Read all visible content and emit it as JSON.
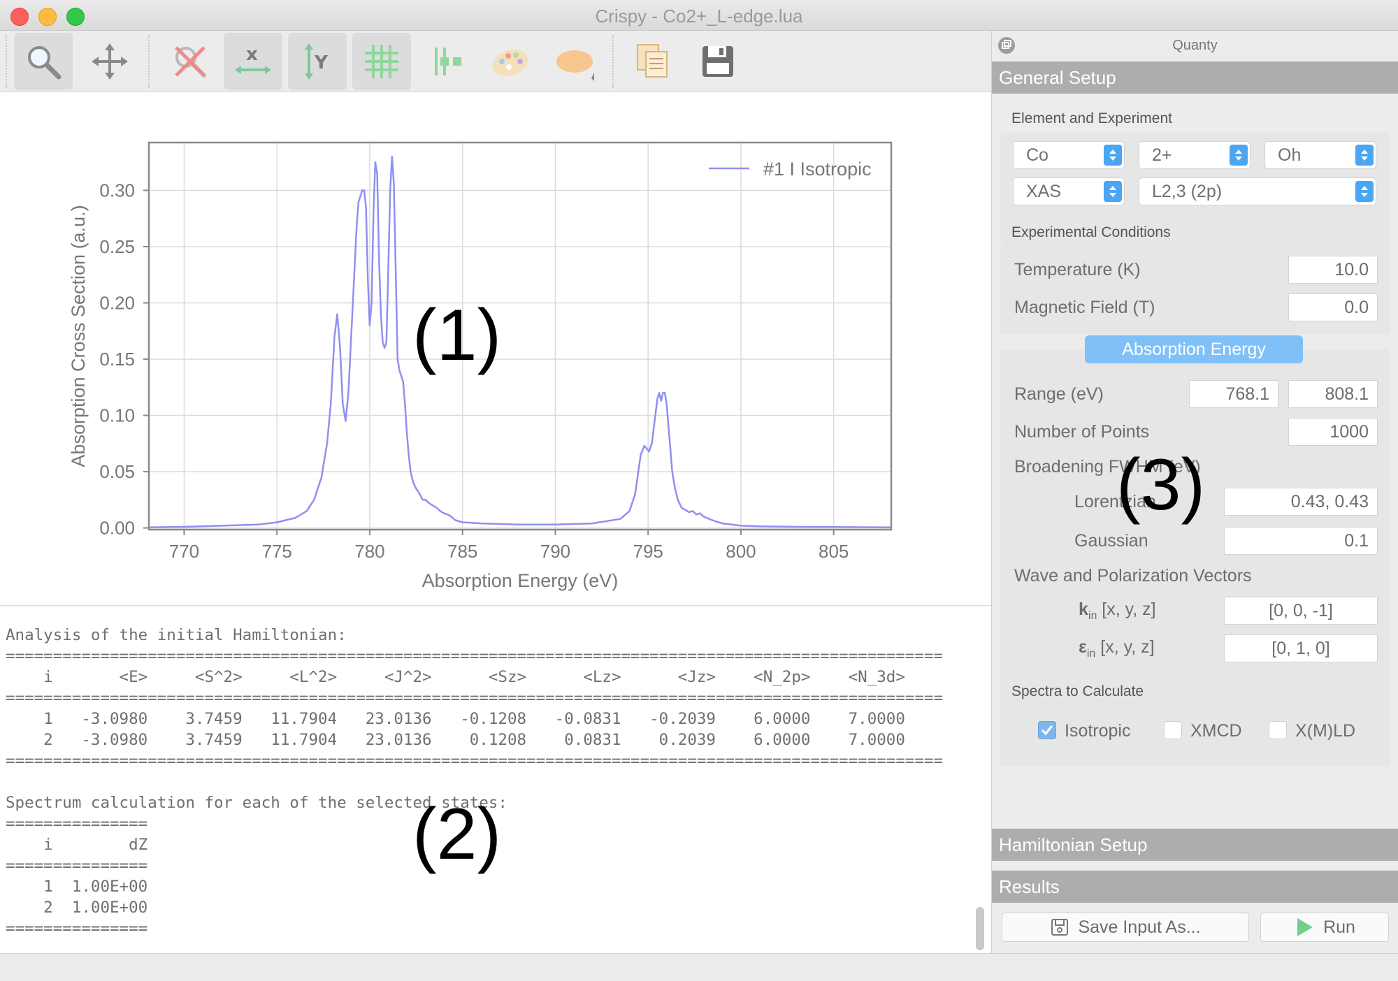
{
  "window": {
    "title": "Crispy - Co2+_L-edge.lua"
  },
  "toolbar": {
    "icons": [
      "magnifier-icon",
      "pan-arrows-icon",
      "reset-zoom-icon",
      "x-autoscale-icon",
      "y-autoscale-icon",
      "grid-icon",
      "curve-style-icon",
      "colormap-palette-icon",
      "shape-icon",
      "copy-icon",
      "save-icon"
    ]
  },
  "chart_data": {
    "type": "line",
    "xlabel": "Absorption Energy (eV)",
    "ylabel": "Absorption Cross Section (a.u.)",
    "xlim": [
      768.1,
      808.1
    ],
    "ylim": [
      -0.0015,
      0.3425
    ],
    "xticks": [
      770,
      775,
      780,
      785,
      790,
      795,
      800,
      805
    ],
    "yticks": [
      0.0,
      0.05,
      0.1,
      0.15,
      0.2,
      0.25,
      0.3
    ],
    "ytick_labels": [
      "0.00",
      "0.05",
      "0.10",
      "0.15",
      "0.20",
      "0.25",
      "0.30"
    ],
    "grid": true,
    "legend_position": "top-right",
    "series": [
      {
        "name": "#1 I Isotropic",
        "color": "#8f90f0",
        "x": [
          768.1,
          770,
          772,
          774,
          775,
          776,
          776.6,
          777,
          777.4,
          777.7,
          777.9,
          778.1,
          778.25,
          778.4,
          778.55,
          778.7,
          778.85,
          779.0,
          779.15,
          779.3,
          779.4,
          779.5,
          779.6,
          779.7,
          779.8,
          779.9,
          780.0,
          780.1,
          780.2,
          780.3,
          780.4,
          780.5,
          780.6,
          780.7,
          780.8,
          780.9,
          781.0,
          781.1,
          781.2,
          781.3,
          781.4,
          781.5,
          781.6,
          781.7,
          781.8,
          781.9,
          782.0,
          782.1,
          782.2,
          782.35,
          782.5,
          782.7,
          782.85,
          783.0,
          783.2,
          783.4,
          783.6,
          783.8,
          784.0,
          784.2,
          784.4,
          784.6,
          785,
          786,
          787,
          788,
          790,
          792,
          793.5,
          794,
          794.3,
          794.6,
          794.8,
          794.95,
          795.05,
          795.2,
          795.35,
          795.5,
          795.6,
          795.7,
          795.8,
          795.9,
          796.0,
          796.1,
          796.2,
          796.3,
          796.45,
          796.6,
          796.8,
          797.0,
          797.2,
          797.4,
          797.6,
          797.8,
          798.0,
          798.3,
          798.6,
          799,
          799.5,
          800,
          801,
          803,
          805,
          808.1
        ],
        "y": [
          0.0005,
          0.001,
          0.002,
          0.003,
          0.005,
          0.009,
          0.015,
          0.025,
          0.045,
          0.075,
          0.11,
          0.17,
          0.19,
          0.16,
          0.11,
          0.095,
          0.12,
          0.17,
          0.22,
          0.27,
          0.29,
          0.295,
          0.3,
          0.3,
          0.285,
          0.22,
          0.18,
          0.2,
          0.28,
          0.325,
          0.315,
          0.24,
          0.19,
          0.165,
          0.16,
          0.165,
          0.23,
          0.3,
          0.33,
          0.305,
          0.23,
          0.15,
          0.14,
          0.135,
          0.13,
          0.11,
          0.085,
          0.065,
          0.05,
          0.04,
          0.035,
          0.03,
          0.025,
          0.025,
          0.022,
          0.02,
          0.018,
          0.015,
          0.013,
          0.012,
          0.01,
          0.007,
          0.005,
          0.004,
          0.0035,
          0.003,
          0.003,
          0.004,
          0.008,
          0.015,
          0.03,
          0.065,
          0.073,
          0.07,
          0.068,
          0.075,
          0.095,
          0.115,
          0.12,
          0.113,
          0.12,
          0.12,
          0.11,
          0.09,
          0.07,
          0.05,
          0.035,
          0.025,
          0.018,
          0.016,
          0.014,
          0.015,
          0.012,
          0.013,
          0.01,
          0.008,
          0.006,
          0.004,
          0.003,
          0.002,
          0.0015,
          0.001,
          0.0008,
          0.0005
        ]
      }
    ]
  },
  "annotations": {
    "plot": "(1)",
    "log": "(2)",
    "dock": "(3)"
  },
  "log": {
    "text": "Analysis of the initial Hamiltonian:\n===================================================================================================\n    i       <E>     <S^2>     <L^2>     <J^2>      <Sz>      <Lz>      <Jz>    <N_2p>    <N_3d>\n===================================================================================================\n    1   -3.0980    3.7459   11.7904   23.0136   -0.1208   -0.0831   -0.2039    6.0000    7.0000\n    2   -3.0980    3.7459   11.7904   23.0136    0.1208    0.0831    0.2039    6.0000    7.0000\n===================================================================================================\n\nSpectrum calculation for each of the selected states:\n===============\n    i        dZ\n===============\n    1  1.00E+00\n    2  1.00E+00\n==============="
  },
  "dock": {
    "title": "Quanty",
    "general_setup": "General Setup",
    "element_experiment": "Element and Experiment",
    "element": "Co",
    "charge": "2+",
    "symmetry": "Oh",
    "experiment": "XAS",
    "edge": "L2,3 (2p)",
    "experimental_conditions": "Experimental Conditions",
    "temperature_label": "Temperature (K)",
    "temperature": "10.0",
    "magnetic_field_label": "Magnetic Field (T)",
    "magnetic_field": "0.0",
    "absorption_tab": "Absorption Energy",
    "range_label": "Range (eV)",
    "range_min": "768.1",
    "range_max": "808.1",
    "npoints_label": "Number of Points",
    "npoints": "1000",
    "broadening_label": "Broadening FWHM (eV)",
    "lorentzian_label": "Lorentzian",
    "lorentzian": "0.43, 0.43",
    "gaussian_label": "Gaussian",
    "gaussian": "0.1",
    "wave_label": "Wave and Polarization Vectors",
    "kin_symbol": "k",
    "kin_sub": "in",
    "kin_label": " [x, y, z]",
    "kin": "[0, 0, -1]",
    "ein_symbol": "ε",
    "ein_sub": "in",
    "ein_label": " [x, y, z]",
    "ein": "[0, 1, 0]",
    "spectra_label": "Spectra to Calculate",
    "isotropic": "Isotropic",
    "isotropic_checked": true,
    "xmcd": "XMCD",
    "xmld": "X(M)LD",
    "hamiltonian_setup": "Hamiltonian Setup",
    "results": "Results",
    "save_input": "Save Input As...",
    "run": "Run"
  }
}
